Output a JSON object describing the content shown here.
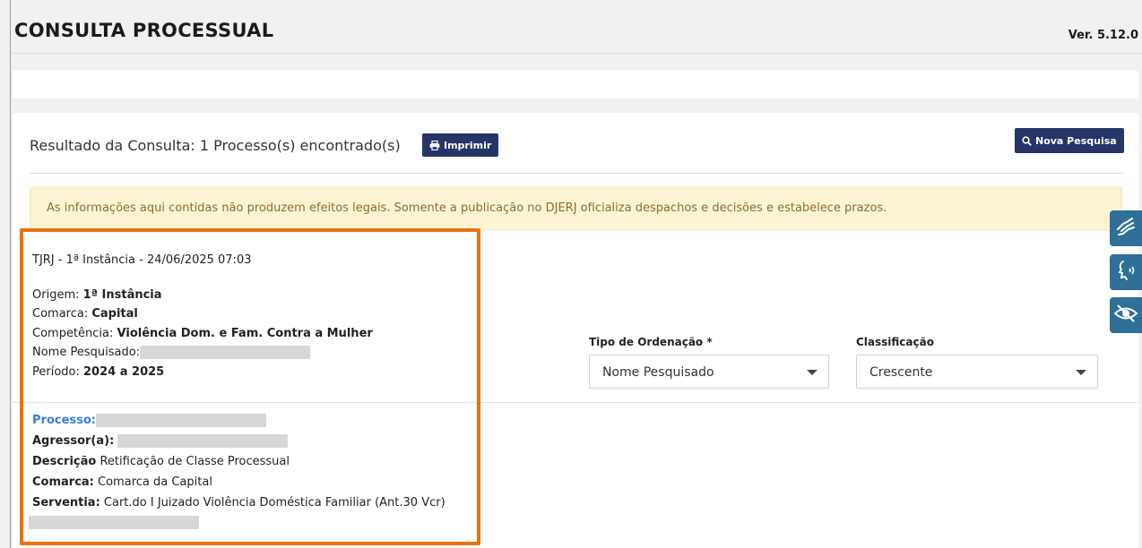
{
  "header": {
    "title": "CONSULTA PROCESSUAL",
    "version": "Ver. 5.12.0"
  },
  "results": {
    "summary": "Resultado da Consulta: 1 Processo(s) encontrado(s)",
    "print_label": "Imprimir",
    "new_search_label": "Nova Pesquisa"
  },
  "alert": {
    "text": "As informações aqui contidas não produzem efeitos legais. Somente a publicação no DJERJ oficializa despachos e decisões e estabelece prazos."
  },
  "query": {
    "header": "TJRJ - 1ª Instância - 24/06/2025 07:03",
    "origem_label": "Origem:",
    "origem_value": "1ª Instância",
    "comarca_label": "Comarca:",
    "comarca_value": "Capital",
    "competencia_label": "Competência:",
    "competencia_value": "Violência Dom. e Fam. Contra a Mulher",
    "nome_label": "Nome Pesquisado:",
    "periodo_label": "Período:",
    "periodo_value": "2024 a 2025"
  },
  "process": {
    "processo_label": "Processo:",
    "agressor_label": "Agressor(a):",
    "descricao_label": "Descrição",
    "descricao_value": "Retificação de Classe Processual",
    "comarca_label": "Comarca:",
    "comarca_value": "Comarca da Capital",
    "serventia_label": "Serventia:",
    "serventia_value": "Cart.do I Juizado Violência Doméstica Familiar (Ant.30 Vcr)"
  },
  "sorting": {
    "order_label": "Tipo de Ordenação *",
    "order_value": "Nome Pesquisado",
    "class_label": "Classificação",
    "class_value": "Crescente"
  },
  "colors": {
    "button": "#253566",
    "highlight": "#e8730f",
    "alert_bg": "#fcf4d2",
    "link": "#3a7dd8",
    "side_button": "#2f6f98"
  },
  "icons": {
    "print": "printer-icon",
    "search": "search-icon",
    "sign_language": "sign-language-icon",
    "voice": "voice-icon",
    "contrast": "eye-slash-icon"
  }
}
